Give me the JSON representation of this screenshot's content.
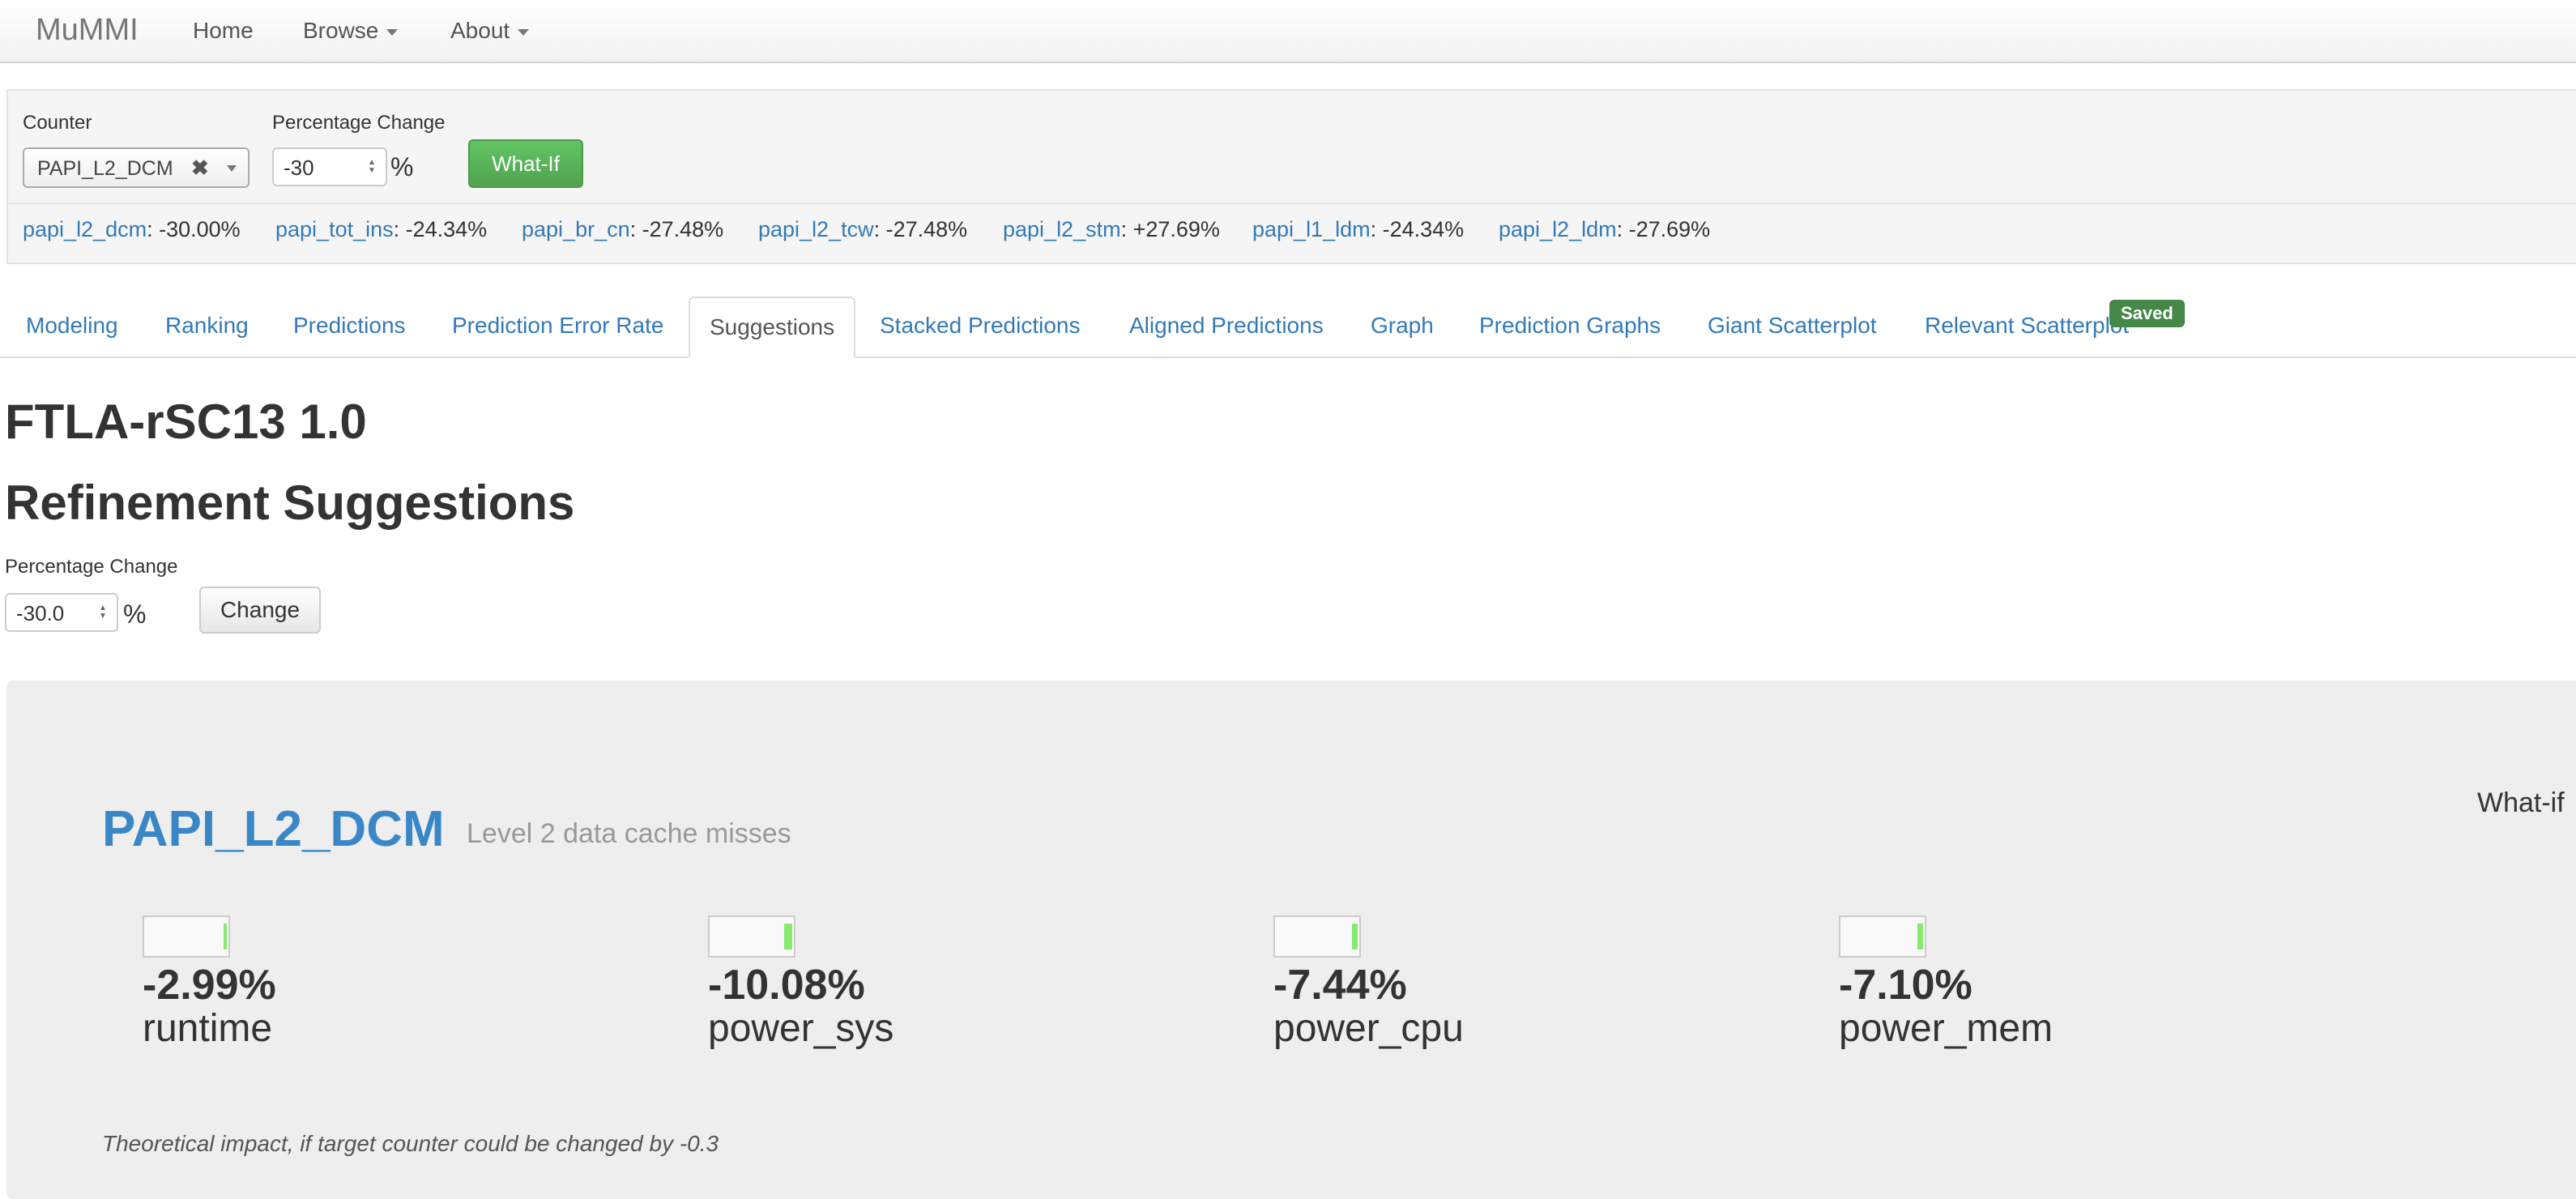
{
  "navbar": {
    "brand": "MuMMI",
    "items": [
      {
        "label": "Home"
      },
      {
        "label": "Browse"
      },
      {
        "label": "About"
      }
    ]
  },
  "whatif_panel": {
    "counter_label": "Counter",
    "counter_value": "PAPI_L2_DCM",
    "pct_label": "Percentage Change",
    "pct_value": "-30",
    "pct_unit": "%",
    "button_label": "What-If",
    "impacts": [
      {
        "name": "papi_l2_dcm",
        "value": ": -30.00%"
      },
      {
        "name": "papi_tot_ins",
        "value": ": -24.34%"
      },
      {
        "name": "papi_br_cn",
        "value": ": -27.48%"
      },
      {
        "name": "papi_l2_tcw",
        "value": ": -27.48%"
      },
      {
        "name": "papi_l2_stm",
        "value": ": +27.69%"
      },
      {
        "name": "papi_l1_ldm",
        "value": ": -24.34%"
      },
      {
        "name": "papi_l2_ldm",
        "value": ": -27.69%"
      }
    ]
  },
  "tabs": [
    {
      "label": "Modeling"
    },
    {
      "label": "Ranking"
    },
    {
      "label": "Predictions"
    },
    {
      "label": "Prediction Error Rate"
    },
    {
      "label": "Suggestions",
      "active": true
    },
    {
      "label": "Stacked Predictions"
    },
    {
      "label": "Aligned Predictions"
    },
    {
      "label": "Graph"
    },
    {
      "label": "Prediction Graphs"
    },
    {
      "label": "Giant Scatterplot"
    },
    {
      "label": "Relevant Scatterplot"
    }
  ],
  "saved_badge": "Saved",
  "page": {
    "title": "FTLA-rSC13 1.0",
    "subtitle": "Refinement Suggestions",
    "pct_label": "Percentage Change",
    "pct_value": "-30.0",
    "pct_unit": "%",
    "change_button": "Change"
  },
  "suggestion": {
    "counter": "PAPI_L2_DCM",
    "description": "Level 2 data cache misses",
    "whatif_link": "What-if",
    "metrics": [
      {
        "value": "-2.99%",
        "name": "runtime",
        "fill": 0.0299
      },
      {
        "value": "-10.08%",
        "name": "power_sys",
        "fill": 0.1008
      },
      {
        "value": "-7.44%",
        "name": "power_cpu",
        "fill": 0.0744
      },
      {
        "value": "-7.10%",
        "name": "power_mem",
        "fill": 0.071
      }
    ],
    "footnote": "Theoretical impact, if target counter could be changed by -0.3"
  },
  "colors": {
    "link": "#337ab7",
    "counter_title": "#3a87c8",
    "what_if_button": "#5cb85c",
    "saved_badge": "#468847",
    "bar_fill": "#87e96e"
  }
}
